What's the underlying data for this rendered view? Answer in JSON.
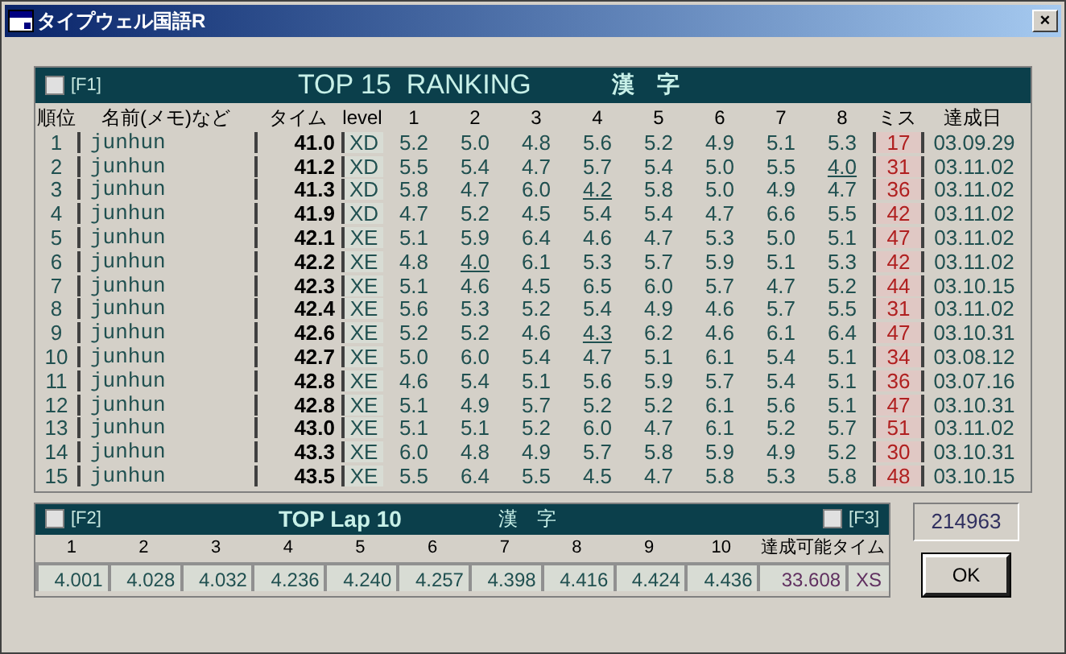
{
  "window": {
    "title": "タイプウェル国語R",
    "close": "×"
  },
  "ranking": {
    "toggle": {
      "label": "[F1]",
      "checked": false
    },
    "title": "TOP 15  RANKING",
    "category": "漢　字",
    "columns": [
      "順位",
      "名前(メモ)など",
      "タイム",
      "level",
      "1",
      "2",
      "3",
      "4",
      "5",
      "6",
      "7",
      "8",
      "ミス",
      "達成日"
    ],
    "rows": [
      {
        "rank": "1",
        "name": "junhun",
        "time": "41.0",
        "level": "XD",
        "laps": [
          {
            "t": "5.2",
            "best": false
          },
          {
            "t": "5.0",
            "best": false
          },
          {
            "t": "4.8",
            "best": false
          },
          {
            "t": "5.6",
            "best": false
          },
          {
            "t": "5.2",
            "best": false
          },
          {
            "t": "4.9",
            "best": false
          },
          {
            "t": "5.1",
            "best": false
          },
          {
            "t": "5.3",
            "best": false
          }
        ],
        "miss": "17",
        "date": "03.09.29"
      },
      {
        "rank": "2",
        "name": "junhun",
        "time": "41.2",
        "level": "XD",
        "laps": [
          {
            "t": "5.5",
            "best": false
          },
          {
            "t": "5.4",
            "best": false
          },
          {
            "t": "4.7",
            "best": false
          },
          {
            "t": "5.7",
            "best": false
          },
          {
            "t": "5.4",
            "best": false
          },
          {
            "t": "5.0",
            "best": false
          },
          {
            "t": "5.5",
            "best": false
          },
          {
            "t": "4.0",
            "best": true
          }
        ],
        "miss": "31",
        "date": "03.11.02"
      },
      {
        "rank": "3",
        "name": "junhun",
        "time": "41.3",
        "level": "XD",
        "laps": [
          {
            "t": "5.8",
            "best": false
          },
          {
            "t": "4.7",
            "best": false
          },
          {
            "t": "6.0",
            "best": false
          },
          {
            "t": "4.2",
            "best": true
          },
          {
            "t": "5.8",
            "best": false
          },
          {
            "t": "5.0",
            "best": false
          },
          {
            "t": "4.9",
            "best": false
          },
          {
            "t": "4.7",
            "best": false
          }
        ],
        "miss": "36",
        "date": "03.11.02"
      },
      {
        "rank": "4",
        "name": "junhun",
        "time": "41.9",
        "level": "XD",
        "laps": [
          {
            "t": "4.7",
            "best": false
          },
          {
            "t": "5.2",
            "best": false
          },
          {
            "t": "4.5",
            "best": false
          },
          {
            "t": "5.4",
            "best": false
          },
          {
            "t": "5.4",
            "best": false
          },
          {
            "t": "4.7",
            "best": false
          },
          {
            "t": "6.6",
            "best": false
          },
          {
            "t": "5.5",
            "best": false
          }
        ],
        "miss": "42",
        "date": "03.11.02"
      },
      {
        "rank": "5",
        "name": "junhun",
        "time": "42.1",
        "level": "XE",
        "laps": [
          {
            "t": "5.1",
            "best": false
          },
          {
            "t": "5.9",
            "best": false
          },
          {
            "t": "6.4",
            "best": false
          },
          {
            "t": "4.6",
            "best": false
          },
          {
            "t": "4.7",
            "best": false
          },
          {
            "t": "5.3",
            "best": false
          },
          {
            "t": "5.0",
            "best": false
          },
          {
            "t": "5.1",
            "best": false
          }
        ],
        "miss": "47",
        "date": "03.11.02"
      },
      {
        "rank": "6",
        "name": "junhun",
        "time": "42.2",
        "level": "XE",
        "laps": [
          {
            "t": "4.8",
            "best": false
          },
          {
            "t": "4.0",
            "best": true
          },
          {
            "t": "6.1",
            "best": false
          },
          {
            "t": "5.3",
            "best": false
          },
          {
            "t": "5.7",
            "best": false
          },
          {
            "t": "5.9",
            "best": false
          },
          {
            "t": "5.1",
            "best": false
          },
          {
            "t": "5.3",
            "best": false
          }
        ],
        "miss": "42",
        "date": "03.11.02"
      },
      {
        "rank": "7",
        "name": "junhun",
        "time": "42.3",
        "level": "XE",
        "laps": [
          {
            "t": "5.1",
            "best": false
          },
          {
            "t": "4.6",
            "best": false
          },
          {
            "t": "4.5",
            "best": false
          },
          {
            "t": "6.5",
            "best": false
          },
          {
            "t": "6.0",
            "best": false
          },
          {
            "t": "5.7",
            "best": false
          },
          {
            "t": "4.7",
            "best": false
          },
          {
            "t": "5.2",
            "best": false
          }
        ],
        "miss": "44",
        "date": "03.10.15"
      },
      {
        "rank": "8",
        "name": "junhun",
        "time": "42.4",
        "level": "XE",
        "laps": [
          {
            "t": "5.6",
            "best": false
          },
          {
            "t": "5.3",
            "best": false
          },
          {
            "t": "5.2",
            "best": false
          },
          {
            "t": "5.4",
            "best": false
          },
          {
            "t": "4.9",
            "best": false
          },
          {
            "t": "4.6",
            "best": false
          },
          {
            "t": "5.7",
            "best": false
          },
          {
            "t": "5.5",
            "best": false
          }
        ],
        "miss": "31",
        "date": "03.11.02"
      },
      {
        "rank": "9",
        "name": "junhun",
        "time": "42.6",
        "level": "XE",
        "laps": [
          {
            "t": "5.2",
            "best": false
          },
          {
            "t": "5.2",
            "best": false
          },
          {
            "t": "4.6",
            "best": false
          },
          {
            "t": "4.3",
            "best": true
          },
          {
            "t": "6.2",
            "best": false
          },
          {
            "t": "4.6",
            "best": false
          },
          {
            "t": "6.1",
            "best": false
          },
          {
            "t": "6.4",
            "best": false
          }
        ],
        "miss": "47",
        "date": "03.10.31"
      },
      {
        "rank": "10",
        "name": "junhun",
        "time": "42.7",
        "level": "XE",
        "laps": [
          {
            "t": "5.0",
            "best": false
          },
          {
            "t": "6.0",
            "best": false
          },
          {
            "t": "5.4",
            "best": false
          },
          {
            "t": "4.7",
            "best": false
          },
          {
            "t": "5.1",
            "best": false
          },
          {
            "t": "6.1",
            "best": false
          },
          {
            "t": "5.4",
            "best": false
          },
          {
            "t": "5.1",
            "best": false
          }
        ],
        "miss": "34",
        "date": "03.08.12"
      },
      {
        "rank": "11",
        "name": "junhun",
        "time": "42.8",
        "level": "XE",
        "laps": [
          {
            "t": "4.6",
            "best": false
          },
          {
            "t": "5.4",
            "best": false
          },
          {
            "t": "5.1",
            "best": false
          },
          {
            "t": "5.6",
            "best": false
          },
          {
            "t": "5.9",
            "best": false
          },
          {
            "t": "5.7",
            "best": false
          },
          {
            "t": "5.4",
            "best": false
          },
          {
            "t": "5.1",
            "best": false
          }
        ],
        "miss": "36",
        "date": "03.07.16"
      },
      {
        "rank": "12",
        "name": "junhun",
        "time": "42.8",
        "level": "XE",
        "laps": [
          {
            "t": "5.1",
            "best": false
          },
          {
            "t": "4.9",
            "best": false
          },
          {
            "t": "5.7",
            "best": false
          },
          {
            "t": "5.2",
            "best": false
          },
          {
            "t": "5.2",
            "best": false
          },
          {
            "t": "6.1",
            "best": false
          },
          {
            "t": "5.6",
            "best": false
          },
          {
            "t": "5.1",
            "best": false
          }
        ],
        "miss": "47",
        "date": "03.10.31"
      },
      {
        "rank": "13",
        "name": "junhun",
        "time": "43.0",
        "level": "XE",
        "laps": [
          {
            "t": "5.1",
            "best": false
          },
          {
            "t": "5.1",
            "best": false
          },
          {
            "t": "5.2",
            "best": false
          },
          {
            "t": "6.0",
            "best": false
          },
          {
            "t": "4.7",
            "best": false
          },
          {
            "t": "6.1",
            "best": false
          },
          {
            "t": "5.2",
            "best": false
          },
          {
            "t": "5.7",
            "best": false
          }
        ],
        "miss": "51",
        "date": "03.11.02"
      },
      {
        "rank": "14",
        "name": "junhun",
        "time": "43.3",
        "level": "XE",
        "laps": [
          {
            "t": "6.0",
            "best": false
          },
          {
            "t": "4.8",
            "best": false
          },
          {
            "t": "4.9",
            "best": false
          },
          {
            "t": "5.7",
            "best": false
          },
          {
            "t": "5.8",
            "best": false
          },
          {
            "t": "5.9",
            "best": false
          },
          {
            "t": "4.9",
            "best": false
          },
          {
            "t": "5.2",
            "best": false
          }
        ],
        "miss": "30",
        "date": "03.10.31"
      },
      {
        "rank": "15",
        "name": "junhun",
        "time": "43.5",
        "level": "XE",
        "laps": [
          {
            "t": "5.5",
            "best": false
          },
          {
            "t": "6.4",
            "best": false
          },
          {
            "t": "5.5",
            "best": false
          },
          {
            "t": "4.5",
            "best": false
          },
          {
            "t": "4.7",
            "best": false
          },
          {
            "t": "5.8",
            "best": false
          },
          {
            "t": "5.3",
            "best": false
          },
          {
            "t": "5.8",
            "best": false
          }
        ],
        "miss": "48",
        "date": "03.10.15"
      }
    ]
  },
  "lap_top": {
    "toggle": {
      "label": "[F2]",
      "checked": false
    },
    "title": "TOP Lap 10",
    "category": "漢　字",
    "toggle_right": {
      "label": "[F3]",
      "checked": false
    },
    "labels": [
      "1",
      "2",
      "3",
      "4",
      "5",
      "6",
      "7",
      "8",
      "9",
      "10",
      "達成可能タイム"
    ],
    "values": [
      "4.001",
      "4.028",
      "4.032",
      "4.236",
      "4.240",
      "4.257",
      "4.398",
      "4.416",
      "4.424",
      "4.436",
      "33.608",
      "XS"
    ]
  },
  "counter": "214963",
  "ok_button": "OK"
}
